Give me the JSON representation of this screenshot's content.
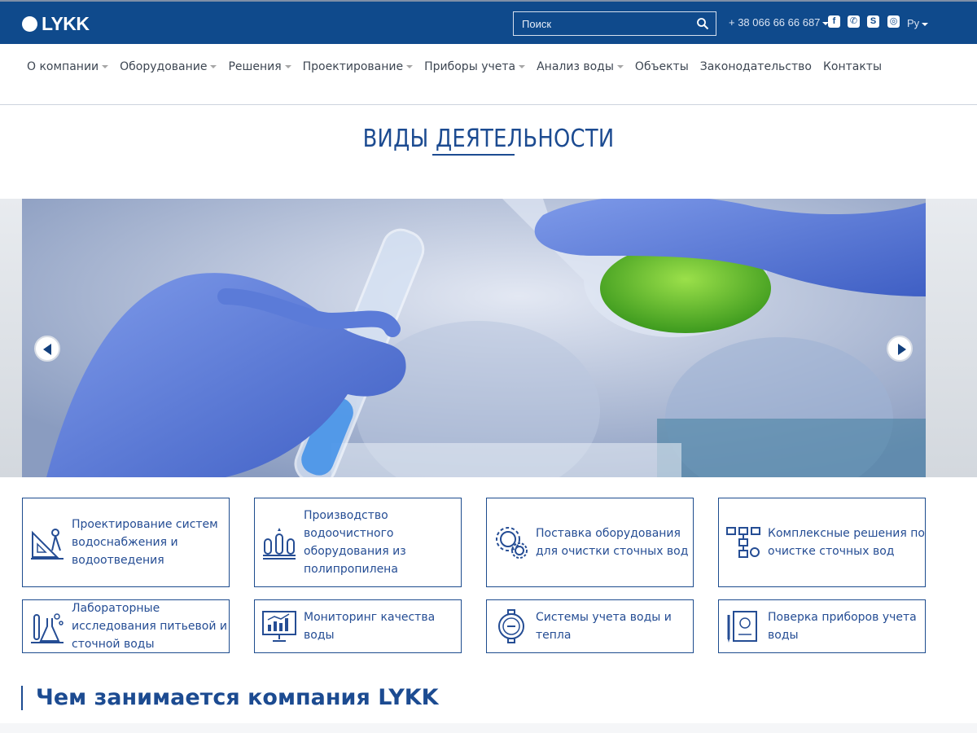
{
  "header": {
    "logo_text": "LYKK",
    "search_placeholder": "Поиск",
    "phone": "+ 38 066 66 66 687",
    "language": "Ру"
  },
  "nav": {
    "items": [
      {
        "label": "О компании",
        "has_dropdown": true
      },
      {
        "label": "Оборудование",
        "has_dropdown": true
      },
      {
        "label": "Решения",
        "has_dropdown": true
      },
      {
        "label": "Проектирование",
        "has_dropdown": true
      },
      {
        "label": "Приборы учета",
        "has_dropdown": true
      },
      {
        "label": "Анализ воды",
        "has_dropdown": true
      },
      {
        "label": "Объекты",
        "has_dropdown": false
      },
      {
        "label": "Законодательство",
        "has_dropdown": false
      },
      {
        "label": "Контакты",
        "has_dropdown": false
      }
    ]
  },
  "section": {
    "title": "ВИДЫ ДЕЯТЕЛЬНОСТИ"
  },
  "cards": [
    {
      "label": "Проектирование систем водоснабжения и водоотведения",
      "icon": "drafting-tools-icon"
    },
    {
      "label": "Производство водоочистного оборудования из полипропилена",
      "icon": "tanks-icon"
    },
    {
      "label": "Поставка оборудования для очистки сточных вод",
      "icon": "gears-icon"
    },
    {
      "label": "Комплексные решения по очистке сточных вод",
      "icon": "flowchart-icon"
    },
    {
      "label": "Лабораторные исследования питьевой и сточной воды",
      "icon": "lab-flask-icon"
    },
    {
      "label": "Мониторинг качества воды",
      "icon": "monitor-chart-icon"
    },
    {
      "label": "Системы учета воды и тепла",
      "icon": "water-meter-icon"
    },
    {
      "label": "Поверка приборов учета воды",
      "icon": "document-pen-icon"
    }
  ],
  "bottom": {
    "heading": "Чем занимается компания LYKK"
  },
  "colors": {
    "brand": "#0f4a8c",
    "text_primary": "#1c4b91"
  }
}
